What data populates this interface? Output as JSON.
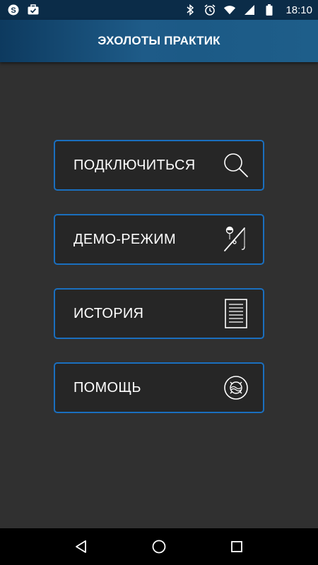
{
  "status_bar": {
    "time": "18:10",
    "left_icons": [
      "skype-icon",
      "briefcase-check-icon"
    ],
    "right_icons": [
      "bluetooth-icon",
      "alarm-clock-icon",
      "wifi-icon",
      "signal-icon",
      "battery-icon"
    ]
  },
  "app_bar": {
    "title": "ЭХОЛОТЫ ПРАКТИК"
  },
  "menu": {
    "items": [
      {
        "label": "ПОДКЛЮЧИТЬСЯ",
        "icon": "search-icon"
      },
      {
        "label": "ДЕМО-РЕЖИМ",
        "icon": "fishing-rod-icon"
      },
      {
        "label": "ИСТОРИЯ",
        "icon": "document-icon"
      },
      {
        "label": "ПОМОЩЬ",
        "icon": "life-buoy-icon"
      }
    ]
  },
  "nav_bar": {
    "buttons": [
      "back-icon",
      "home-icon",
      "recents-icon"
    ]
  },
  "colors": {
    "background": "#303030",
    "button_background": "#262626",
    "button_border": "#1a6fbf",
    "app_bar_start": "#0d3a5f",
    "app_bar_end": "#1e5e8a",
    "status_bar": "#0b2c48",
    "nav_bar": "#000000"
  }
}
